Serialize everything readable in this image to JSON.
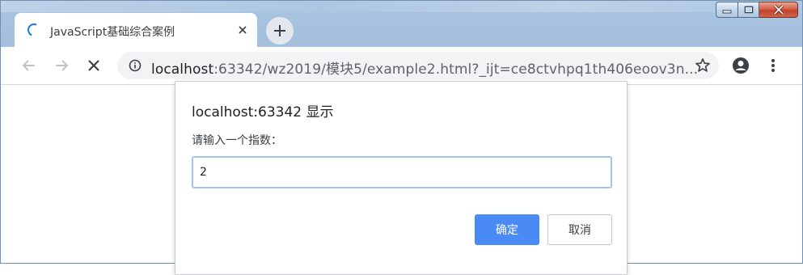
{
  "window": {
    "caption_buttons": [
      {
        "name": "minimize-icon"
      },
      {
        "name": "maximize-icon"
      },
      {
        "name": "close-icon"
      }
    ]
  },
  "tab": {
    "title": "JavaScript基础综合案例",
    "spinner_color": "#1a73e8"
  },
  "toolbar": {
    "url_host": "localhost",
    "url_rest": ":63342/wz2019/模块5/example2.html?_ijt=ce8ctvhpq1th406eoov3n..."
  },
  "dialog": {
    "title": "localhost:63342 显示",
    "message": "请输入一个指数：",
    "input_value": "2",
    "ok_label": "确定",
    "cancel_label": "取消",
    "ok_color": "#4a8af4"
  }
}
